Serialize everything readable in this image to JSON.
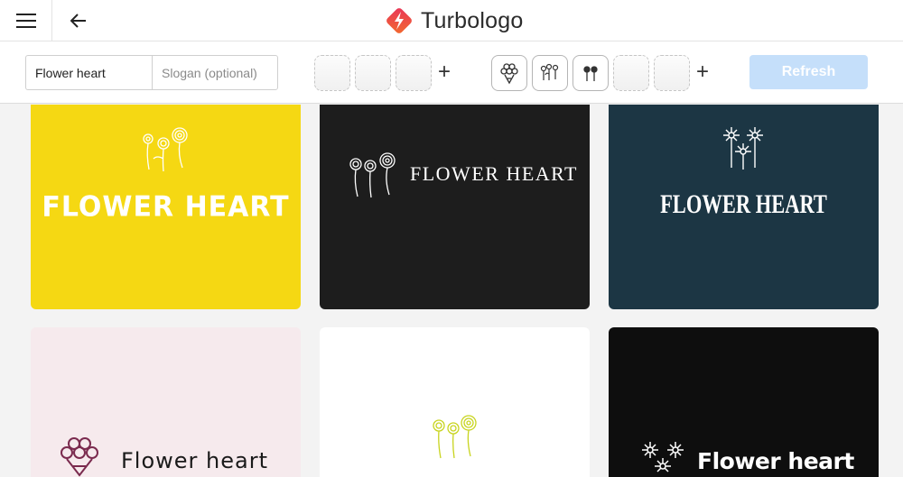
{
  "header": {
    "brand_name": "Turbologo",
    "menu_icon": "hamburger-icon",
    "back_icon": "arrow-left-icon",
    "logo_colors": [
      "#e9355a",
      "#f26a2e"
    ]
  },
  "toolbar": {
    "name_value": "Flower heart",
    "slogan_placeholder": "Slogan (optional)",
    "refresh_label": "Refresh",
    "refresh_color": "#c5dffa",
    "plus_label": "+",
    "icon_names": [
      "bouquet-icon",
      "flowers-icon",
      "two-flowers-icon"
    ]
  },
  "logos": [
    {
      "text": "FLOWER HEART",
      "background": "#f5d813",
      "text_color": "#ffffff"
    },
    {
      "text": "FLOWER HEART",
      "background": "#1d1d1d",
      "text_color": "#ffffff"
    },
    {
      "text": "FLOWER HEART",
      "background": "#1c3644",
      "text_color": "#ffffff"
    },
    {
      "text": "Flower heart",
      "background": "#f6eaed",
      "text_color": "#1a1a1a",
      "icon_color": "#7a2a4e"
    },
    {
      "text": "",
      "background": "#ffffff",
      "icon_color": "#c8d41e"
    },
    {
      "text": "Flower heart",
      "background": "#0e0e0e",
      "text_color": "#ffffff"
    }
  ]
}
